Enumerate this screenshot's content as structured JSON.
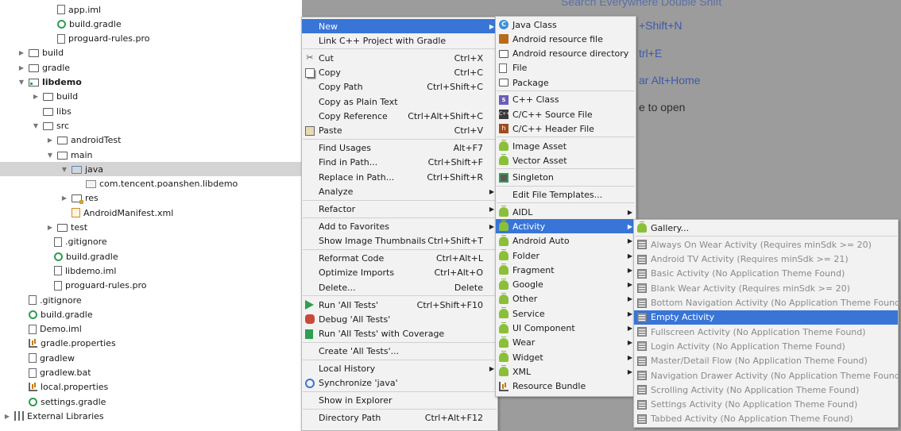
{
  "tree": [
    {
      "label": "app.iml",
      "icon": "file-icon",
      "arrow": "",
      "indent": 58,
      "bold": false
    },
    {
      "label": "build.gradle",
      "icon": "gradle-icon",
      "arrow": "",
      "indent": 58,
      "bold": false
    },
    {
      "label": "proguard-rules.pro",
      "icon": "file-icon",
      "arrow": "",
      "indent": 58,
      "bold": false
    },
    {
      "label": "build",
      "icon": "folder-icon",
      "arrow": "▶",
      "indent": 22,
      "bold": false
    },
    {
      "label": "gradle",
      "icon": "folder-icon",
      "arrow": "▶",
      "indent": 22,
      "bold": false
    },
    {
      "label": "libdemo",
      "icon": "module-icon",
      "arrow": "▼",
      "indent": 22,
      "bold": true
    },
    {
      "label": "build",
      "icon": "folder-icon",
      "arrow": "▶",
      "indent": 40,
      "bold": false
    },
    {
      "label": "libs",
      "icon": "folder-icon",
      "arrow": "",
      "indent": 40,
      "bold": false
    },
    {
      "label": "src",
      "icon": "folder-icon",
      "arrow": "▼",
      "indent": 40,
      "bold": false
    },
    {
      "label": "androidTest",
      "icon": "folder-icon",
      "arrow": "▶",
      "indent": 58,
      "bold": false
    },
    {
      "label": "main",
      "icon": "folder-icon",
      "arrow": "▼",
      "indent": 58,
      "bold": false
    },
    {
      "label": "java",
      "icon": "src-folder-icon",
      "arrow": "▼",
      "indent": 76,
      "bold": false,
      "selected": true
    },
    {
      "label": "com.tencent.poanshen.libdemo",
      "icon": "package-icon",
      "arrow": "",
      "indent": 94,
      "bold": false
    },
    {
      "label": "res",
      "icon": "res-folder-icon",
      "arrow": "▶",
      "indent": 76,
      "bold": false
    },
    {
      "label": "AndroidManifest.xml",
      "icon": "xml-icon",
      "arrow": "",
      "indent": 76,
      "bold": false
    },
    {
      "label": "test",
      "icon": "folder-icon",
      "arrow": "▶",
      "indent": 58,
      "bold": false
    },
    {
      "label": ".gitignore",
      "icon": "file-icon",
      "arrow": "",
      "indent": 54,
      "bold": false
    },
    {
      "label": "build.gradle",
      "icon": "gradle-icon",
      "arrow": "",
      "indent": 54,
      "bold": false
    },
    {
      "label": "libdemo.iml",
      "icon": "file-icon",
      "arrow": "",
      "indent": 54,
      "bold": false
    },
    {
      "label": "proguard-rules.pro",
      "icon": "file-icon",
      "arrow": "",
      "indent": 54,
      "bold": false
    },
    {
      "label": ".gitignore",
      "icon": "file-icon",
      "arrow": "",
      "indent": 22,
      "bold": false
    },
    {
      "label": "build.gradle",
      "icon": "gradle-icon",
      "arrow": "",
      "indent": 22,
      "bold": false
    },
    {
      "label": "Demo.iml",
      "icon": "file-icon",
      "arrow": "",
      "indent": 22,
      "bold": false
    },
    {
      "label": "gradle.properties",
      "icon": "properties-icon",
      "arrow": "",
      "indent": 22,
      "bold": false
    },
    {
      "label": "gradlew",
      "icon": "file-icon",
      "arrow": "",
      "indent": 22,
      "bold": false
    },
    {
      "label": "gradlew.bat",
      "icon": "file-icon",
      "arrow": "",
      "indent": 22,
      "bold": false
    },
    {
      "label": "local.properties",
      "icon": "properties-icon",
      "arrow": "",
      "indent": 22,
      "bold": false
    },
    {
      "label": "settings.gradle",
      "icon": "gradle-icon",
      "arrow": "",
      "indent": 22,
      "bold": false
    },
    {
      "label": "External Libraries",
      "icon": "libraries-icon",
      "arrow": "▶",
      "indent": 4,
      "bold": false
    }
  ],
  "editor_hints": [
    {
      "text": "Search Everywhere Double Shift"
    },
    {
      "text": "+Shift+N"
    },
    {
      "text": "trl+E"
    },
    {
      "text": "ar Alt+Home"
    },
    {
      "text": "e to open"
    }
  ],
  "context_menu": {
    "items": [
      {
        "label": "New",
        "shortcut": "",
        "submenu": true,
        "active": true,
        "icon": ""
      },
      {
        "label": "Link C++ Project with Gradle",
        "shortcut": "",
        "icon": "",
        "sep_after": true
      },
      {
        "label": "Cut",
        "shortcut": "Ctrl+X",
        "icon": "cut-icon"
      },
      {
        "label": "Copy",
        "shortcut": "Ctrl+C",
        "icon": "copy-icon"
      },
      {
        "label": "Copy Path",
        "shortcut": "Ctrl+Shift+C",
        "icon": ""
      },
      {
        "label": "Copy as Plain Text",
        "shortcut": "",
        "icon": ""
      },
      {
        "label": "Copy Reference",
        "shortcut": "Ctrl+Alt+Shift+C",
        "icon": ""
      },
      {
        "label": "Paste",
        "shortcut": "Ctrl+V",
        "icon": "paste-icon",
        "sep_after": true
      },
      {
        "label": "Find Usages",
        "shortcut": "Alt+F7",
        "icon": ""
      },
      {
        "label": "Find in Path...",
        "shortcut": "Ctrl+Shift+F",
        "icon": ""
      },
      {
        "label": "Replace in Path...",
        "shortcut": "Ctrl+Shift+R",
        "icon": ""
      },
      {
        "label": "Analyze",
        "shortcut": "",
        "submenu": true,
        "icon": "",
        "sep_after": true
      },
      {
        "label": "Refactor",
        "shortcut": "",
        "submenu": true,
        "icon": "",
        "sep_after": true
      },
      {
        "label": "Add to Favorites",
        "shortcut": "",
        "submenu": true,
        "icon": ""
      },
      {
        "label": "Show Image Thumbnails",
        "shortcut": "Ctrl+Shift+T",
        "icon": "",
        "sep_after": true
      },
      {
        "label": "Reformat Code",
        "shortcut": "Ctrl+Alt+L",
        "icon": ""
      },
      {
        "label": "Optimize Imports",
        "shortcut": "Ctrl+Alt+O",
        "icon": ""
      },
      {
        "label": "Delete...",
        "shortcut": "Delete",
        "icon": "",
        "sep_after": true
      },
      {
        "label": "Run 'All Tests'",
        "shortcut": "Ctrl+Shift+F10",
        "icon": "run-icon"
      },
      {
        "label": "Debug 'All Tests'",
        "shortcut": "",
        "icon": "debug-icon"
      },
      {
        "label": "Run 'All Tests' with Coverage",
        "shortcut": "",
        "icon": "coverage-icon",
        "sep_after": true
      },
      {
        "label": "Create 'All Tests'...",
        "shortcut": "",
        "icon": "",
        "sep_after": true
      },
      {
        "label": "Local History",
        "shortcut": "",
        "submenu": true,
        "icon": ""
      },
      {
        "label": "Synchronize 'java'",
        "shortcut": "",
        "icon": "sync-icon",
        "sep_after": true
      },
      {
        "label": "Show in Explorer",
        "shortcut": "",
        "icon": "",
        "sep_after": true
      },
      {
        "label": "Directory Path",
        "shortcut": "Ctrl+Alt+F12",
        "icon": ""
      }
    ]
  },
  "new_menu": {
    "items": [
      {
        "label": "Java Class",
        "icon": "class-icon"
      },
      {
        "label": "Android resource file",
        "icon": "android-resource-icon"
      },
      {
        "label": "Android resource directory",
        "icon": "folder-icon"
      },
      {
        "label": "File",
        "icon": "file-icon"
      },
      {
        "label": "Package",
        "icon": "package-icon",
        "sep_after": true
      },
      {
        "label": "C++ Class",
        "icon": "cpp-class-icon"
      },
      {
        "label": "C/C++ Source File",
        "icon": "cpp-source-icon"
      },
      {
        "label": "C/C++ Header File",
        "icon": "header-file-icon",
        "sep_after": true
      },
      {
        "label": "Image Asset",
        "icon": "android-icon"
      },
      {
        "label": "Vector Asset",
        "icon": "android-icon",
        "sep_after": true
      },
      {
        "label": "Singleton",
        "icon": "singleton-icon",
        "sep_after": true
      },
      {
        "label": "Edit File Templates...",
        "icon": "",
        "sep_after": true
      },
      {
        "label": "AIDL",
        "icon": "android-icon",
        "submenu": true
      },
      {
        "label": "Activity",
        "icon": "android-icon",
        "submenu": true,
        "active": true
      },
      {
        "label": "Android Auto",
        "icon": "android-icon",
        "submenu": true
      },
      {
        "label": "Folder",
        "icon": "android-icon",
        "submenu": true
      },
      {
        "label": "Fragment",
        "icon": "android-icon",
        "submenu": true
      },
      {
        "label": "Google",
        "icon": "android-icon",
        "submenu": true
      },
      {
        "label": "Other",
        "icon": "android-icon",
        "submenu": true
      },
      {
        "label": "Service",
        "icon": "android-icon",
        "submenu": true
      },
      {
        "label": "UI Component",
        "icon": "android-icon",
        "submenu": true
      },
      {
        "label": "Wear",
        "icon": "android-icon",
        "submenu": true
      },
      {
        "label": "Widget",
        "icon": "android-icon",
        "submenu": true
      },
      {
        "label": "XML",
        "icon": "android-icon",
        "submenu": true
      },
      {
        "label": "Resource Bundle",
        "icon": "resource-bundle-icon"
      }
    ]
  },
  "activity_menu": {
    "items": [
      {
        "label": "Gallery...",
        "icon": "android-icon",
        "sep_after": true
      },
      {
        "label": "Always On Wear Activity (Requires minSdk >= 20)",
        "icon": "activity-template-icon",
        "disabled": true
      },
      {
        "label": "Android TV Activity (Requires minSdk >= 21)",
        "icon": "activity-template-icon",
        "disabled": true
      },
      {
        "label": "Basic Activity (No Application Theme Found)",
        "icon": "activity-template-icon",
        "disabled": true
      },
      {
        "label": "Blank Wear Activity (Requires minSdk >= 20)",
        "icon": "activity-template-icon",
        "disabled": true
      },
      {
        "label": "Bottom Navigation Activity (No Application Theme Found)",
        "icon": "activity-template-icon",
        "disabled": true
      },
      {
        "label": "Empty Activity",
        "icon": "activity-template-icon",
        "active": true
      },
      {
        "label": "Fullscreen Activity (No Application Theme Found)",
        "icon": "activity-template-icon",
        "disabled": true
      },
      {
        "label": "Login Activity (No Application Theme Found)",
        "icon": "activity-template-icon",
        "disabled": true
      },
      {
        "label": "Master/Detail Flow (No Application Theme Found)",
        "icon": "activity-template-icon",
        "disabled": true
      },
      {
        "label": "Navigation Drawer Activity (No Application Theme Found)",
        "icon": "activity-template-icon",
        "disabled": true
      },
      {
        "label": "Scrolling Activity (No Application Theme Found)",
        "icon": "activity-template-icon",
        "disabled": true
      },
      {
        "label": "Settings Activity (No Application Theme Found)",
        "icon": "activity-template-icon",
        "disabled": true
      },
      {
        "label": "Tabbed Activity (No Application Theme Found)",
        "icon": "activity-template-icon",
        "disabled": true
      }
    ]
  },
  "colors": {
    "selection": "#3875d7",
    "menu_bg": "#f2f2f2",
    "editor_bg": "#9c9c9c",
    "hint_link": "#3b5aa8",
    "android_green": "#8bbf3a"
  }
}
